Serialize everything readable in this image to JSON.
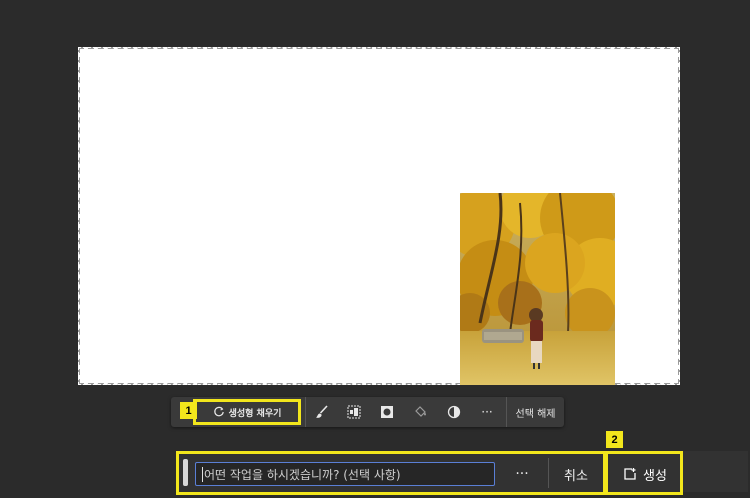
{
  "taskbar": {
    "generative_fill_label": "생성형 채우기",
    "more_label": "···",
    "deselect_label": "선택 해제"
  },
  "prompt_bar": {
    "placeholder": "어떤 작업을 하시겠습니까?  (선택 사항)",
    "more_label": "···",
    "cancel_label": "취소",
    "generate_label": "생성"
  },
  "callouts": {
    "first": "1",
    "second": "2"
  },
  "colors": {
    "highlight": "#f2e61c",
    "workspace": "#2b2b2b",
    "bar": "#3a3a3a",
    "input_focus": "#5a7fd6"
  }
}
